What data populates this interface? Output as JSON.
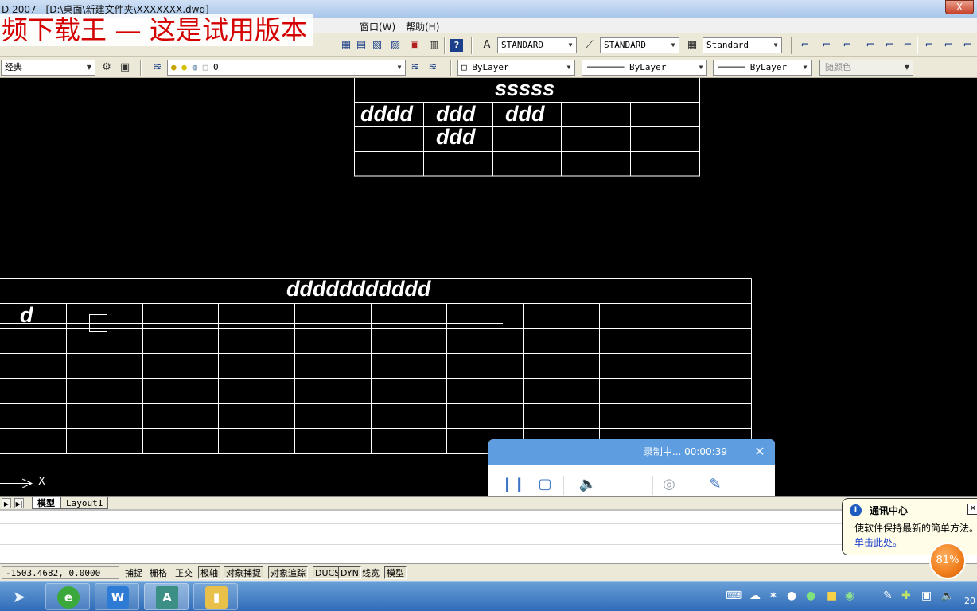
{
  "window": {
    "title": "D 2007 - [D:\\桌面\\新建文件夹\\XXXXXXX.dwg]",
    "close_label": "X"
  },
  "watermark": {
    "text": "频下载王 — 这是试用版本"
  },
  "menu": {
    "items": [
      "窗口(W)",
      "帮助(H)"
    ]
  },
  "toolbar1": {
    "text_style": "STANDARD",
    "dim_style": "STANDARD",
    "table_style": "Standard"
  },
  "toolbar2": {
    "workspace": "经典",
    "layer": "0",
    "color": "ByLayer",
    "linetype": "ByLayer",
    "lineweight": "ByLayer",
    "plotstyle": "随颜色"
  },
  "drawing": {
    "table1": {
      "title": "sssss",
      "cells": [
        "dddd",
        "ddd",
        "ddd",
        "ddd"
      ]
    },
    "table2": {
      "title": "ddddddddddd",
      "cell": "d"
    },
    "ucs_label": "X"
  },
  "tabs": {
    "model": "模型",
    "layout1": "Layout1"
  },
  "status": {
    "coords": "-1503.4682, 0.0000",
    "buttons": [
      "捕捉",
      "栅格",
      "正交",
      "极轴",
      "对象捕捉",
      "对象追踪",
      "DUCS",
      "DYN",
      "线宽",
      "模型"
    ]
  },
  "recorder": {
    "title": "录制中... 00:00:39"
  },
  "notification": {
    "title": "通讯中心",
    "body": "使软件保持最新的简单方法。",
    "link": "单击此处。"
  },
  "badge": {
    "value": "81%"
  },
  "clock": {
    "text": "20"
  },
  "colors": {
    "accent": "#5d9de0",
    "watermark": "#d40000",
    "badge": "#f07c1a"
  }
}
